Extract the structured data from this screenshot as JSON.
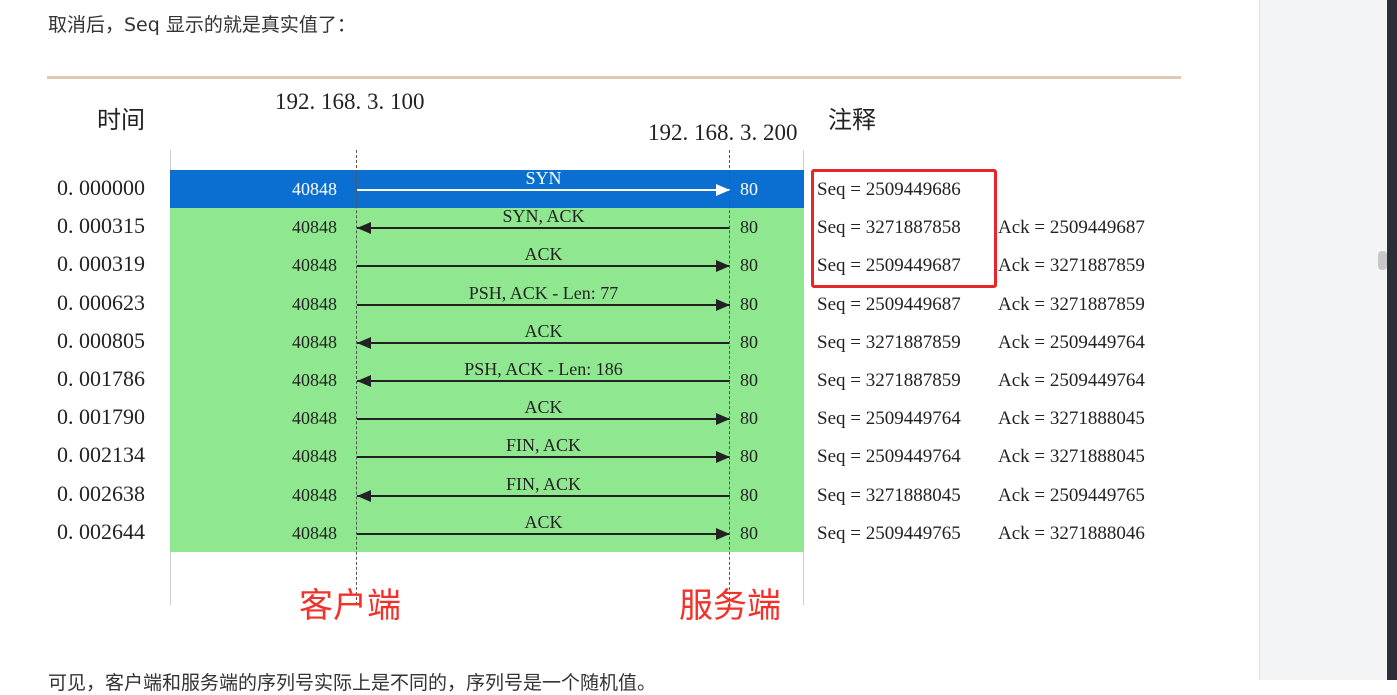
{
  "intro_text": "取消后，Seq 显示的就是真实值了：",
  "outro_text": "可见，客户端和服务端的序列号实际上是不同的，序列号是一个随机值。",
  "diagram": {
    "time_header": "时间",
    "client_ip": "192. 168. 3. 100",
    "server_ip": "192. 168. 3. 200",
    "note_header": "注释",
    "client_label": "客户端",
    "server_label": "服务端",
    "colors": {
      "highlight": "#0a6fd0",
      "rows": "#8fe88f",
      "callout": "#e8262a"
    },
    "rows": [
      {
        "time": "0. 000000",
        "src": "40848",
        "dst": "80",
        "msg": "SYN",
        "dir": "right",
        "seq": "Seq = 2509449686",
        "ack": ""
      },
      {
        "time": "0. 000315",
        "src": "40848",
        "dst": "80",
        "msg": "SYN, ACK",
        "dir": "left",
        "seq": "Seq = 3271887858",
        "ack": "Ack = 2509449687"
      },
      {
        "time": "0. 000319",
        "src": "40848",
        "dst": "80",
        "msg": "ACK",
        "dir": "right",
        "seq": "Seq = 2509449687",
        "ack": "Ack = 3271887859"
      },
      {
        "time": "0. 000623",
        "src": "40848",
        "dst": "80",
        "msg": "PSH, ACK - Len: 77",
        "dir": "right",
        "seq": "Seq = 2509449687",
        "ack": "Ack = 3271887859"
      },
      {
        "time": "0. 000805",
        "src": "40848",
        "dst": "80",
        "msg": "ACK",
        "dir": "left",
        "seq": "Seq = 3271887859",
        "ack": "Ack = 2509449764"
      },
      {
        "time": "0. 001786",
        "src": "40848",
        "dst": "80",
        "msg": "PSH, ACK - Len: 186",
        "dir": "left",
        "seq": "Seq = 3271887859",
        "ack": "Ack = 2509449764"
      },
      {
        "time": "0. 001790",
        "src": "40848",
        "dst": "80",
        "msg": "ACK",
        "dir": "right",
        "seq": "Seq = 2509449764",
        "ack": "Ack = 3271888045"
      },
      {
        "time": "0. 002134",
        "src": "40848",
        "dst": "80",
        "msg": "FIN, ACK",
        "dir": "right",
        "seq": "Seq = 2509449764",
        "ack": "Ack = 3271888045"
      },
      {
        "time": "0. 002638",
        "src": "40848",
        "dst": "80",
        "msg": "FIN, ACK",
        "dir": "left",
        "seq": "Seq = 3271888045",
        "ack": "Ack = 2509449765"
      },
      {
        "time": "0. 002644",
        "src": "40848",
        "dst": "80",
        "msg": "ACK",
        "dir": "right",
        "seq": "Seq = 2509449765",
        "ack": "Ack = 3271888046"
      }
    ]
  }
}
